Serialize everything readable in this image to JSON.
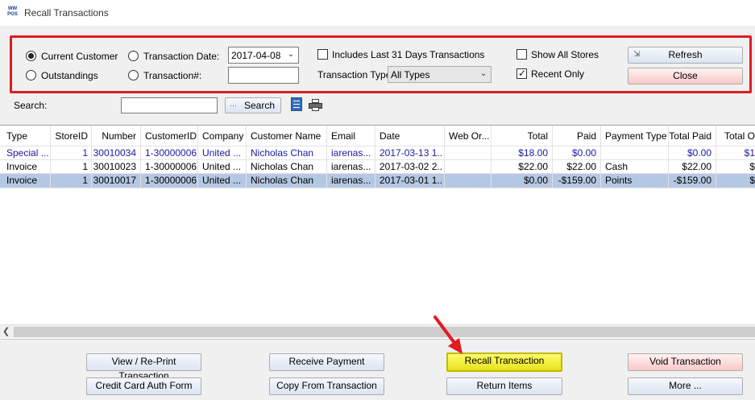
{
  "window": {
    "title": "Recall Transactions",
    "logo_text": "WW POS"
  },
  "filters": {
    "radios": [
      {
        "label": "Current Customer",
        "checked": true
      },
      {
        "label": "Outstandings",
        "checked": false
      },
      {
        "label": "Transaction Date:",
        "checked": false
      },
      {
        "label": "Transaction#:",
        "checked": false
      }
    ],
    "transaction_date": "2017-04-08",
    "transaction_number": "",
    "includes_31_days": {
      "label": "Includes Last 31 Days Transactions",
      "checked": false
    },
    "transaction_type_label": "Transaction Type:",
    "transaction_type_value": "All Types",
    "show_all_stores": {
      "label": "Show All Stores",
      "checked": false
    },
    "recent_only": {
      "label": "Recent Only",
      "checked": true
    },
    "refresh_label": "Refresh",
    "close_label": "Close",
    "highlight_color": "#e01b22"
  },
  "search": {
    "label": "Search:",
    "value": "",
    "button_label": "Search"
  },
  "table": {
    "columns": [
      "Type",
      "StoreID",
      "Number",
      "CustomerID",
      "Company",
      "Customer Name",
      "Email",
      "Date",
      "Web Or...",
      "Total",
      "Paid",
      "Payment Type",
      "Total Paid",
      "Total O"
    ],
    "rows": [
      [
        "Special ...",
        "1",
        "30010034",
        "1-30000006",
        "United ...",
        "Nicholas Chan",
        "iarenas...",
        "2017-03-13 1...",
        "",
        "$18.00",
        "$0.00",
        "",
        "$0.00",
        "$1"
      ],
      [
        "Invoice",
        "1",
        "30010023",
        "1-30000006",
        "United ...",
        "Nicholas Chan",
        "iarenas...",
        "2017-03-02 2...",
        "",
        "$22.00",
        "$22.00",
        "Cash",
        "$22.00",
        "$"
      ],
      [
        "Invoice",
        "1",
        "30010017",
        "1-30000006",
        "United ...",
        "Nicholas Chan",
        "iarenas...",
        "2017-03-01 1...",
        "",
        "$0.00",
        "-$159.00",
        "Points",
        "-$159.00",
        "$"
      ]
    ],
    "row_colors": [
      "#1a1aa0",
      "#000000",
      "#000000"
    ],
    "selected_row": 2
  },
  "actions": {
    "view_reprint": "View / Re-Print Transaction",
    "credit_card_auth": "Credit Card Auth Form",
    "receive_payment": "Receive Payment",
    "copy_from": "Copy From Transaction",
    "recall": "Recall Transaction",
    "return_items": "Return Items",
    "void": "Void Transaction",
    "more": "More ..."
  },
  "annotation": {
    "arrow_color": "#e01b22"
  }
}
